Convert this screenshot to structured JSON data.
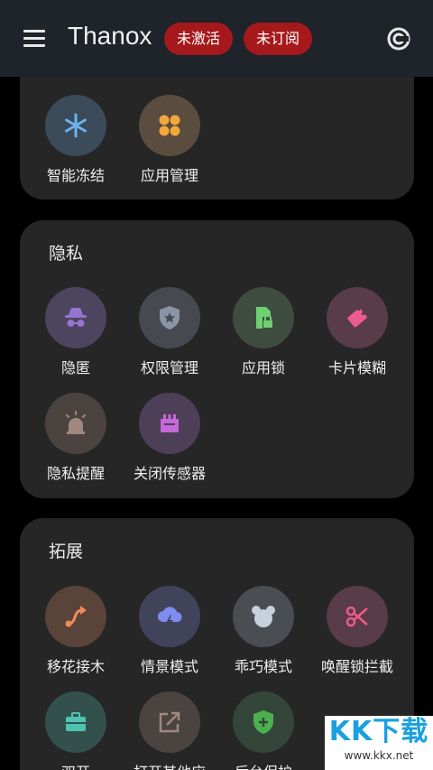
{
  "appbar": {
    "title": "Thanox",
    "badge_activate": "未激活",
    "badge_subscribe": "未订阅",
    "menu_icon": "menu-icon",
    "refresh_icon": "refresh-icon"
  },
  "sections": {
    "first": {
      "items": [
        {
          "label": "智能冻结",
          "icon": "snowflake-icon",
          "color": "#6ab3f0"
        },
        {
          "label": "应用管理",
          "icon": "apps-grid-icon",
          "color": "#f3a73a"
        }
      ]
    },
    "privacy": {
      "title": "隐私",
      "items": [
        {
          "label": "隐匿",
          "icon": "incognito-icon",
          "color": "#9575cd"
        },
        {
          "label": "权限管理",
          "icon": "shield-star-icon",
          "color": "#8a94a6"
        },
        {
          "label": "应用锁",
          "icon": "app-lock-icon",
          "color": "#6fcf73"
        },
        {
          "label": "卡片模糊",
          "icon": "blur-card-icon",
          "color": "#ec5b8c"
        },
        {
          "label": "隐私提醒",
          "icon": "alarm-light-icon",
          "color": "#a1887f"
        },
        {
          "label": "关闭传感器",
          "icon": "sensor-off-icon",
          "color": "#c46ad8"
        }
      ]
    },
    "extend": {
      "title": "拓展",
      "items": [
        {
          "label": "移花接木",
          "icon": "route-icon",
          "color": "#f08a5d"
        },
        {
          "label": "情景模式",
          "icon": "weather-bolt-icon",
          "color": "#7f8cf0"
        },
        {
          "label": "乖巧模式",
          "icon": "bear-icon",
          "color": "#c7d0db"
        },
        {
          "label": "唤醒锁拦截",
          "icon": "scissors-icon",
          "color": "#ee5b8a"
        },
        {
          "label": "双开",
          "icon": "briefcase-icon",
          "color": "#4fc3b0"
        },
        {
          "label": "打开其他应",
          "icon": "open-external-icon",
          "color": "#a1887f"
        },
        {
          "label": "后台保护",
          "icon": "shield-plus-icon",
          "color": "#4caf50"
        }
      ]
    }
  },
  "watermark": {
    "logo_text": "KK下载",
    "url": "www.kkx.net"
  }
}
